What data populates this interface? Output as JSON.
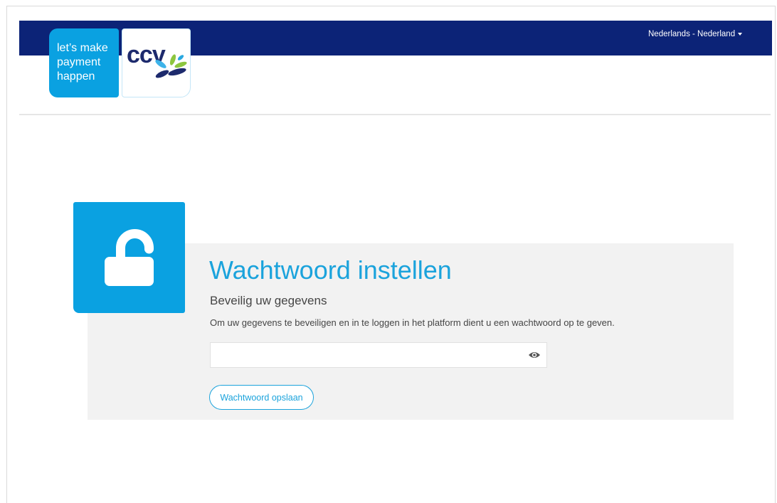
{
  "header": {
    "language": "Nederlands - Nederland",
    "logo": {
      "tagline_lines": [
        "let’s make",
        "payment",
        "happen"
      ],
      "brand": "ccv"
    }
  },
  "main": {
    "title": "Wachtwoord instellen",
    "subtitle": "Beveilig uw gegevens",
    "description": "Om uw gegevens te beveiligen en in te loggen in het platform dient u een wachtwoord op te geven.",
    "save_button_label": "Wachtwoord opslaan"
  },
  "icons": {
    "hero": "unlock-icon",
    "password_toggle": "eye-icon",
    "language_caret": "caret-down-icon",
    "logo_mark": "ccv-flower-logo-icon"
  },
  "colors": {
    "navy": "#0c2377",
    "brand_blue": "#0aa1e1",
    "title_blue": "#1ba3dc",
    "panel_gray": "#f2f2f2",
    "text_dark": "#454545"
  }
}
